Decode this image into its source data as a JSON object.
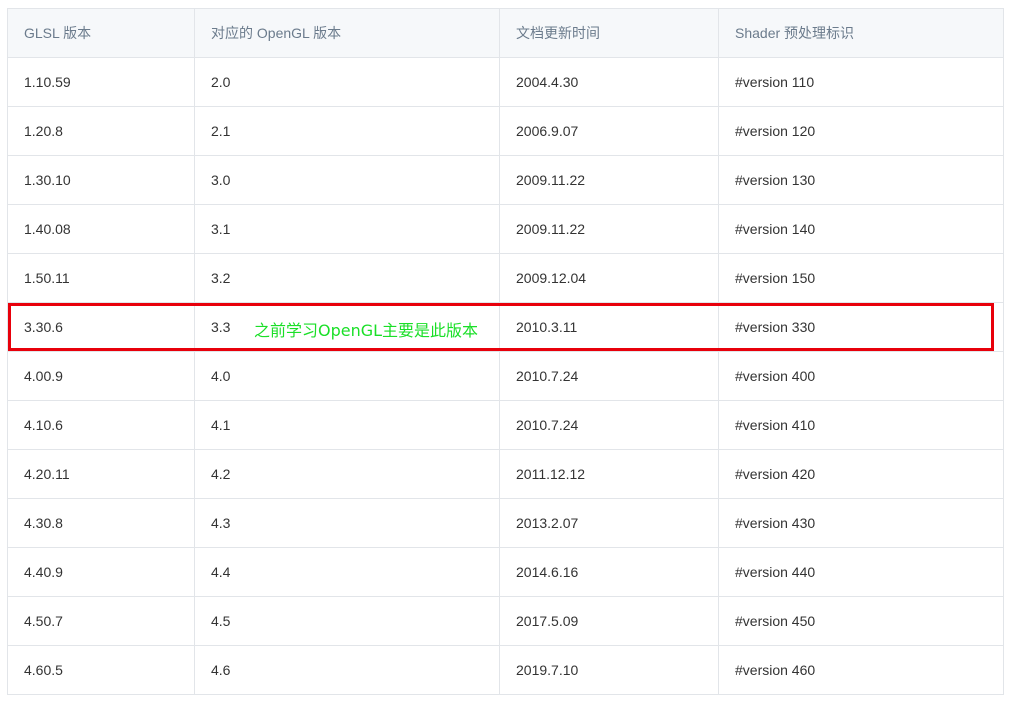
{
  "table": {
    "headers": [
      "GLSL 版本",
      "对应的 OpenGL 版本",
      "文档更新时间",
      "Shader 预处理标识"
    ],
    "rows": [
      [
        "1.10.59",
        "2.0",
        "2004.4.30",
        "#version 110"
      ],
      [
        "1.20.8",
        "2.1",
        "2006.9.07",
        "#version 120"
      ],
      [
        "1.30.10",
        "3.0",
        "2009.11.22",
        "#version 130"
      ],
      [
        "1.40.08",
        "3.1",
        "2009.11.22",
        "#version 140"
      ],
      [
        "1.50.11",
        "3.2",
        "2009.12.04",
        "#version 150"
      ],
      [
        "3.30.6",
        "3.3",
        "2010.3.11",
        "#version 330"
      ],
      [
        "4.00.9",
        "4.0",
        "2010.7.24",
        "#version 400"
      ],
      [
        "4.10.6",
        "4.1",
        "2010.7.24",
        "#version 410"
      ],
      [
        "4.20.11",
        "4.2",
        "2011.12.12",
        "#version 420"
      ],
      [
        "4.30.8",
        "4.3",
        "2013.2.07",
        "#version 430"
      ],
      [
        "4.40.9",
        "4.4",
        "2014.6.16",
        "#version 440"
      ],
      [
        "4.50.7",
        "4.5",
        "2017.5.09",
        "#version 450"
      ],
      [
        "4.60.5",
        "4.6",
        "2019.7.10",
        "#version 460"
      ]
    ]
  },
  "annotation": {
    "text": "之前学习OpenGL主要是此版本",
    "text_color": "#1adf27",
    "box_color": "#e8000b"
  },
  "colors": {
    "header_bg": "#f6f8fa",
    "header_text": "#6b7b8c",
    "border": "#e2e5e9",
    "cell_text": "#333333"
  }
}
